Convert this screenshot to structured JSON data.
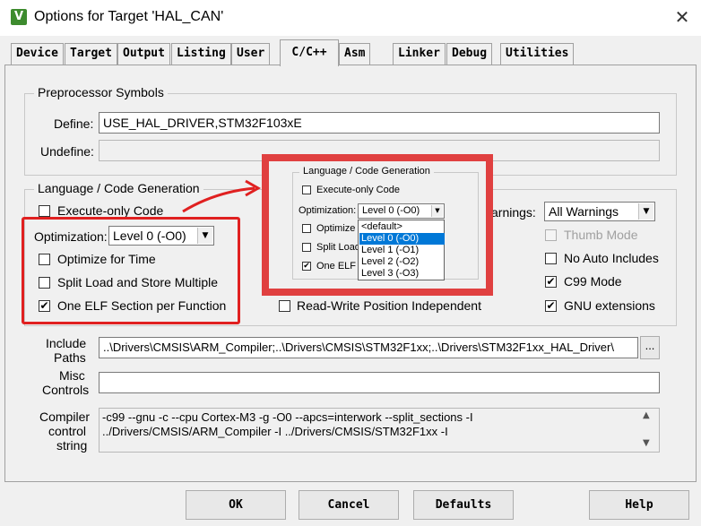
{
  "window": {
    "title": "Options for Target 'HAL_CAN'",
    "app_icon_glyph": "V",
    "close_glyph": "✕"
  },
  "tabs": [
    {
      "label": "Device"
    },
    {
      "label": "Target"
    },
    {
      "label": "Output"
    },
    {
      "label": "Listing"
    },
    {
      "label": "User"
    },
    {
      "label": "C/C++"
    },
    {
      "label": "Asm"
    },
    {
      "label": "Linker"
    },
    {
      "label": "Debug"
    },
    {
      "label": "Utilities"
    }
  ],
  "active_tab": "C/C++",
  "preprocessor": {
    "group_title": "Preprocessor Symbols",
    "define_label": "Define:",
    "define_value": "USE_HAL_DRIVER,STM32F103xE",
    "undefine_label": "Undefine:",
    "undefine_value": ""
  },
  "langgen": {
    "group_title": "Language / Code Generation",
    "execute_only": {
      "label": "Execute-only Code",
      "checked": false
    },
    "optimization_label": "Optimization:",
    "optimization_value": "Level 0 (-O0)",
    "optimize_for_time": {
      "label": "Optimize for Time",
      "checked": false
    },
    "split_load_store": {
      "label": "Split Load and Store Multiple",
      "checked": false
    },
    "one_elf_section": {
      "label": "One ELF Section per Function",
      "checked": true
    },
    "rw_position_independent": {
      "label": "Read-Write Position Independent",
      "checked": false
    },
    "warnings_label": "arnings:",
    "warnings_value": "All Warnings",
    "thumb_mode": {
      "label": "Thumb Mode",
      "checked": false,
      "disabled": true
    },
    "no_auto_includes": {
      "label": "No Auto Includes",
      "checked": false
    },
    "c99_mode": {
      "label": "C99 Mode",
      "checked": true
    },
    "gnu_extensions": {
      "label": "GNU extensions",
      "checked": true
    }
  },
  "include_paths": {
    "label_line1": "Include",
    "label_line2": "Paths",
    "value": "..\\Drivers\\CMSIS\\ARM_Compiler;..\\Drivers\\CMSIS\\STM32F1xx;..\\Drivers\\STM32F1xx_HAL_Driver\\",
    "browse_label": "..."
  },
  "misc_controls": {
    "label_line1": "Misc",
    "label_line2": "Controls",
    "value": ""
  },
  "compiler_control": {
    "label_line1": "Compiler",
    "label_line2": "control",
    "label_line3": "string",
    "line1": "-c99 --gnu -c --cpu Cortex-M3 -g -O0 --apcs=interwork --split_sections -I",
    "line2": "../Drivers/CMSIS/ARM_Compiler -I ../Drivers/CMSIS/STM32F1xx -I",
    "scroll_up": "▲",
    "scroll_down": "▼"
  },
  "buttons": {
    "ok": "OK",
    "cancel": "Cancel",
    "defaults": "Defaults",
    "help": "Help"
  },
  "zoom_inset": {
    "group_title": "Language / Code Generation",
    "execute_only_label": "Execute-only Code",
    "optimization_label": "Optimization:",
    "optimization_value": "Level 0 (-O0)",
    "optimize_partial": "Optimize f",
    "split_partial": "Split Load",
    "one_elf_partial": "One ELF",
    "dropdown_options": [
      "<default>",
      "Level 0 (-O0)",
      "Level 1 (-O1)",
      "Level 2 (-O2)",
      "Level 3 (-O3)"
    ],
    "selected_option": "Level 0 (-O0)"
  },
  "colors": {
    "highlight_red": "#e02020",
    "selection_blue": "#0078d7",
    "dialog_bg": "#f0f0f0"
  }
}
